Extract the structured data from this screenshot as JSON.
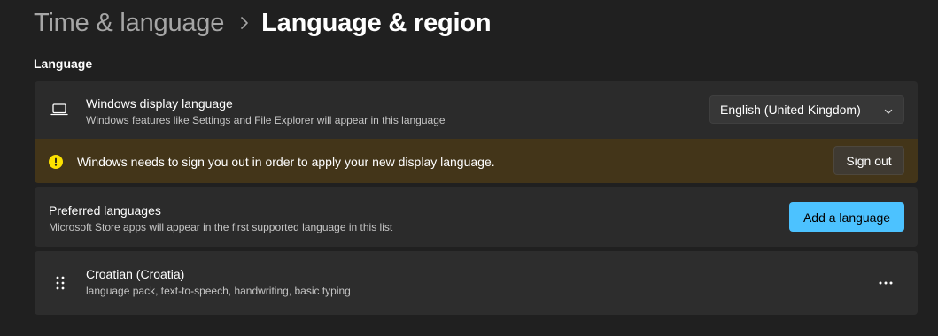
{
  "breadcrumb": {
    "parent": "Time & language",
    "current": "Language & region"
  },
  "section": {
    "title": "Language"
  },
  "display_language": {
    "icon": "laptop-icon",
    "title": "Windows display language",
    "subtitle": "Windows features like Settings and File Explorer will appear in this language",
    "selected": "English (United Kingdom)"
  },
  "warning": {
    "icon": "warning-icon",
    "message": "Windows needs to sign you out in order to apply your new display language.",
    "button_label": "Sign out"
  },
  "preferred_languages": {
    "title": "Preferred languages",
    "subtitle": "Microsoft Store apps will appear in the first supported language in this list",
    "button_label": "Add a language"
  },
  "languages": [
    {
      "icon": "drag-handle-icon",
      "name": "Croatian (Croatia)",
      "features": "language pack, text-to-speech, handwriting, basic typing"
    }
  ],
  "colors": {
    "background": "#202020",
    "card": "#2b2b2b",
    "warning_bg": "#433519",
    "warning_icon": "#fce100",
    "accent": "#4cc2ff"
  }
}
